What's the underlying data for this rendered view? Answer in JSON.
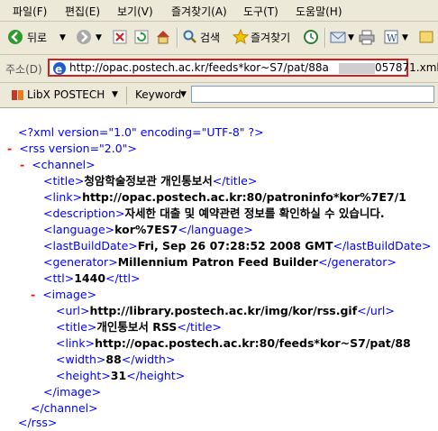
{
  "menu": [
    "파일(F)",
    "편집(E)",
    "보기(V)",
    "즐겨찾기(A)",
    "도구(T)",
    "도움말(H)"
  ],
  "toolbar": {
    "back": "뒤로",
    "search": "검색",
    "favorites": "즐겨찾기"
  },
  "address": {
    "label": "주소(D)",
    "url_start": "http://opac.postech.ac.kr/feeds*kor~S7/pat/88a",
    "url_end": "057871.xml"
  },
  "libx": {
    "label": "LibX POSTECH",
    "keyword": "Keyword"
  },
  "xml": {
    "decl": "<?xml version=\"1.0\" encoding=\"UTF-8\" ?>",
    "rss_open": "<rss version=\"2.0\">",
    "channel_open": "<channel>",
    "title": {
      "open": "<title>",
      "text": "청암학술정보관 개인통보서",
      "close": "</title>"
    },
    "link": {
      "open": "<link>",
      "text": "http://opac.postech.ac.kr:80/patroninfo*kor%7E7/1"
    },
    "description": {
      "open": "<description>",
      "text": "자세한 대출 및 예약관련 정보를 확인하실 수 있습니다."
    },
    "language": {
      "open": "<language>",
      "text": "kor%7ES7",
      "close": "</language>"
    },
    "lastBuildDate": {
      "open": "<lastBuildDate>",
      "text": "Fri, Sep 26 07:28:52 2008 GMT",
      "close": "</lastBuildDate>"
    },
    "generator": {
      "open": "<generator>",
      "text": "Millennium Patron Feed Builder",
      "close": "</generator>"
    },
    "ttl": {
      "open": "<ttl>",
      "text": "1440",
      "close": "</ttl>"
    },
    "image_open": "<image>",
    "url": {
      "open": "<url>",
      "text": "http://library.postech.ac.kr/img/kor/rss.gif",
      "close": "</url>"
    },
    "img_title": {
      "open": "<title>",
      "text": "개인통보서 RSS",
      "close": "</title>"
    },
    "img_link": {
      "open": "<link>",
      "text": "http://opac.postech.ac.kr:80/feeds*kor~S7/pat/88"
    },
    "width": {
      "open": "<width>",
      "text": "88",
      "close": "</width>"
    },
    "height": {
      "open": "<height>",
      "text": "31",
      "close": "</height>"
    },
    "image_close": "</image>",
    "channel_close": "</channel>",
    "rss_close": "</rss>"
  },
  "colors": {
    "chrome": "#ece9d8",
    "markup": "#0000ff",
    "tag": "#990000",
    "collapse": "#ff0000",
    "highlight": "#d01f1f"
  }
}
